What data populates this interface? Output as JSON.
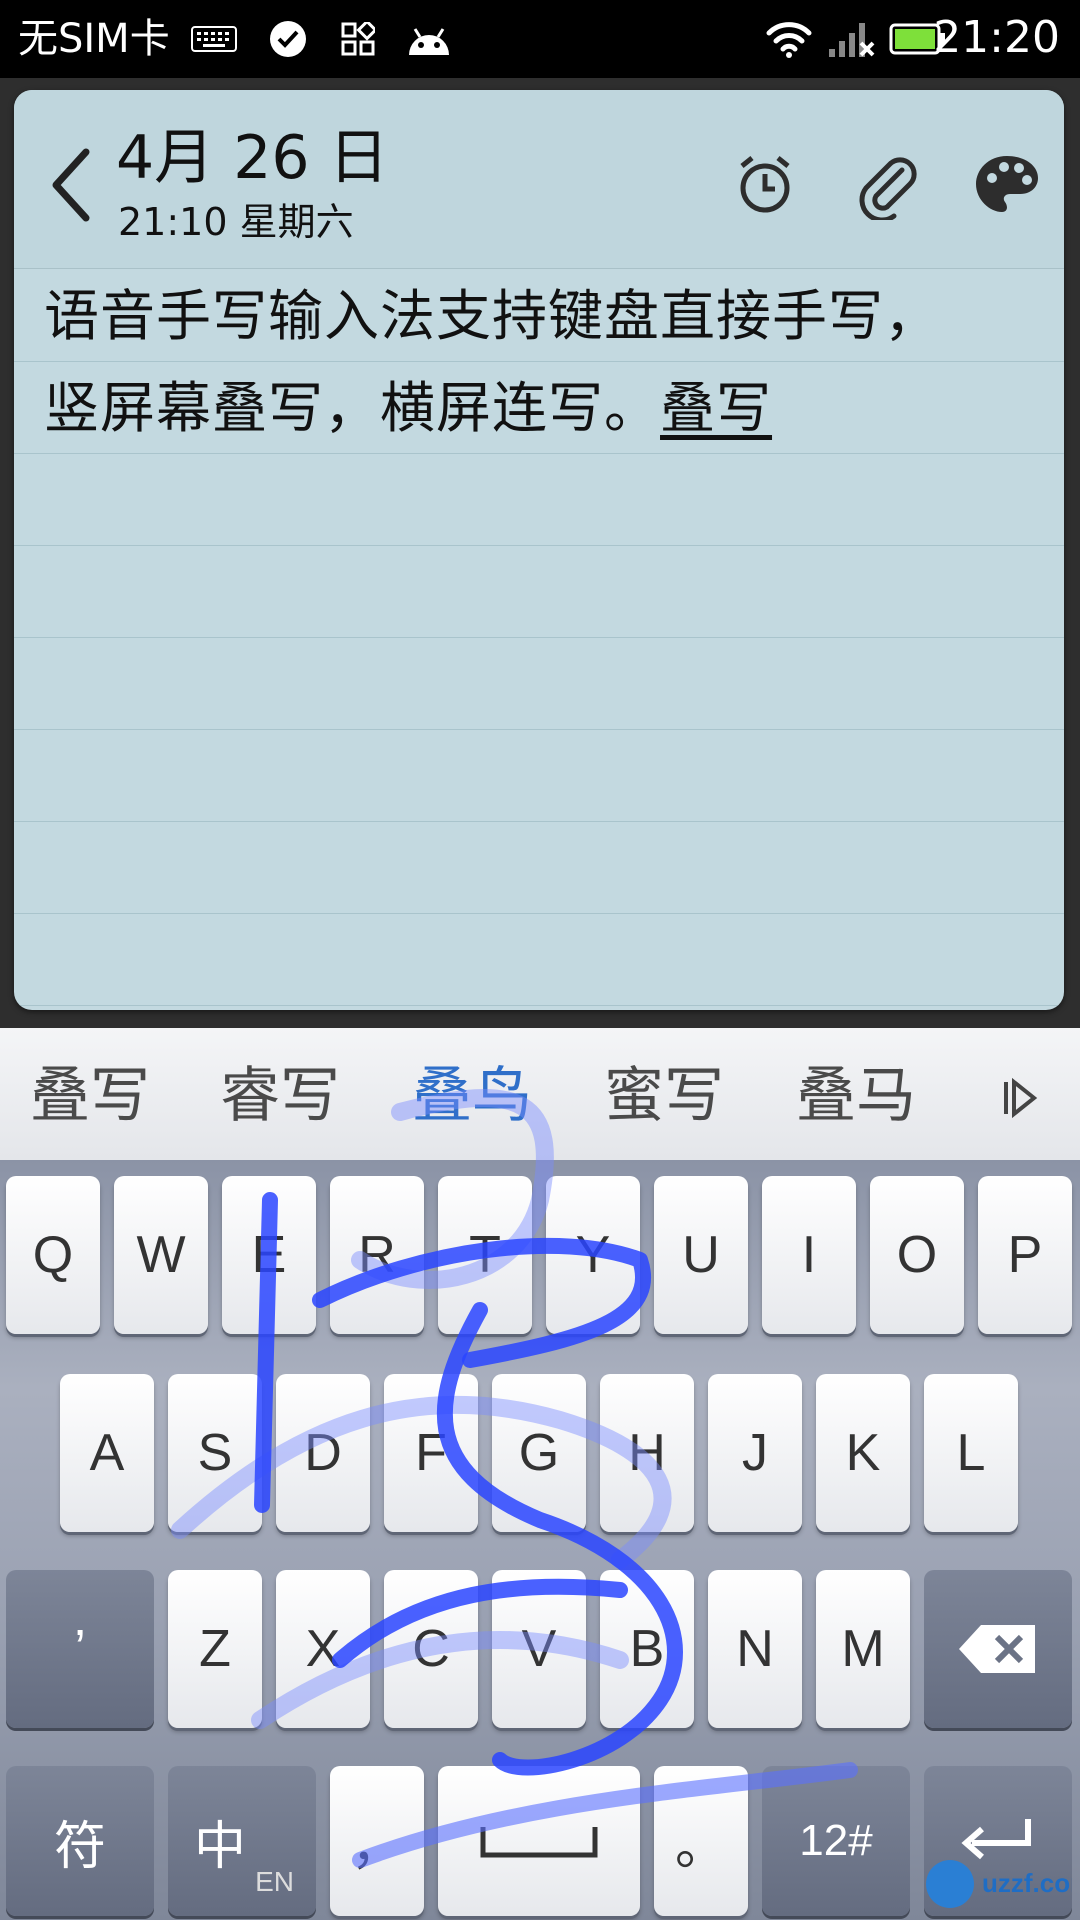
{
  "status_bar": {
    "carrier": "无SIM卡",
    "time": "21:20",
    "icons": [
      "keyboard-icon",
      "check-icon",
      "apps-icon",
      "android-icon",
      "wifi-icon",
      "signal-x-icon",
      "battery-icon"
    ]
  },
  "note": {
    "date": "4月 26 日",
    "time_day": "21:10 星期六",
    "lines": [
      {
        "text": "语音手写输入法支持键盘直接手写，"
      },
      {
        "prefix": "竖屏幕叠写，横屏连写。",
        "composing": "叠写"
      }
    ],
    "header_icons": [
      "alarm-icon",
      "paperclip-icon",
      "palette-icon"
    ]
  },
  "candidates": {
    "items": [
      "叠写",
      "睿写",
      "叠鸟",
      "蜜写",
      "叠马"
    ],
    "highlight_color": "#2f6fc9"
  },
  "keyboard": {
    "row1": [
      "Q",
      "W",
      "E",
      "R",
      "T",
      "Y",
      "U",
      "I",
      "O",
      "P"
    ],
    "row2": [
      "A",
      "S",
      "D",
      "F",
      "G",
      "H",
      "J",
      "K",
      "L"
    ],
    "row3": [
      "’",
      "Z",
      "X",
      "C",
      "V",
      "B",
      "N",
      "M"
    ],
    "row4": {
      "symbol": "符",
      "lang_main": "中",
      "lang_sub": "EN",
      "comma": "，",
      "period": "。",
      "num": "12#"
    }
  },
  "watermark": "uzzf.com",
  "ink_color": "#1f3fff"
}
